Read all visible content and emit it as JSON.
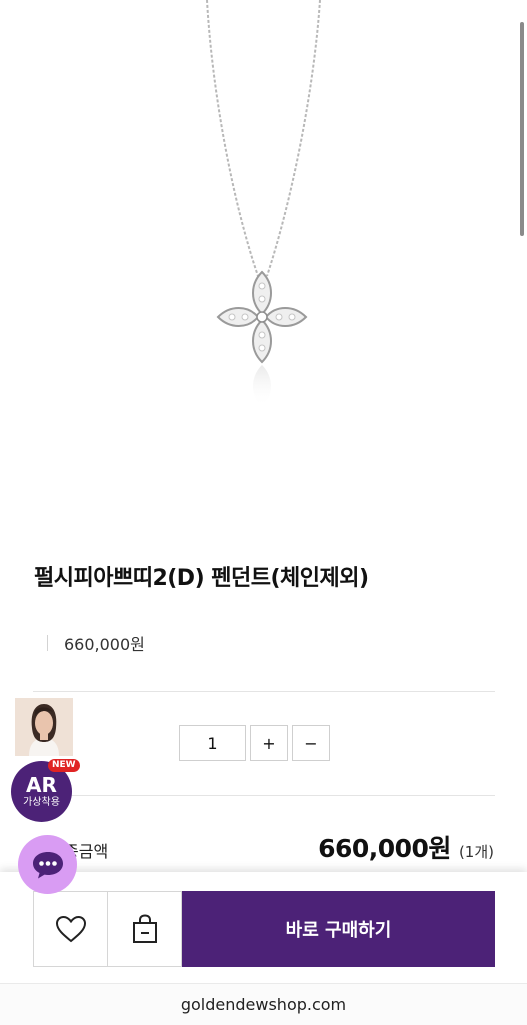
{
  "product": {
    "title": "펄시피아쁘띠2(D) 펜던트(체인제외)",
    "price": "660,000원"
  },
  "quantity": {
    "value": "1",
    "plus_label": "+",
    "minus_label": "−"
  },
  "total": {
    "label_partial": "종금액",
    "amount": "660,000원",
    "count": "(1개)"
  },
  "ar": {
    "title": "AR",
    "subtitle": "가상착용",
    "new_badge": "NEW"
  },
  "actions": {
    "buy_label": "바로 구매하기"
  },
  "browser": {
    "url": "goldendewshop.com"
  },
  "colors": {
    "brand_purple": "#4c2277",
    "chat_bubble": "#d99cf3",
    "new_badge": "#e02424"
  },
  "icons": [
    "heart-icon",
    "shopping-bag-icon",
    "chat-icon"
  ]
}
